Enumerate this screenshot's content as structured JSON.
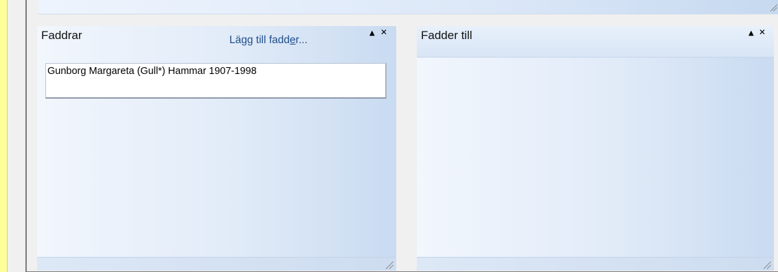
{
  "left_panel": {
    "title": "Faddrar",
    "add_link": {
      "prefix": "Lägg till fadd",
      "mnemonic": "e",
      "suffix": "r..."
    },
    "collapse_glyph": "▲",
    "close_glyph": "✕",
    "items": [
      {
        "label": "Gunborg Margareta (Gull*) Hammar 1907-1998"
      }
    ]
  },
  "right_panel": {
    "title": "Fadder till",
    "collapse_glyph": "▲",
    "close_glyph": "✕"
  },
  "icons": {
    "collapse": "triangle-up-icon",
    "close": "close-x-icon",
    "resize": "resize-grip-icon"
  },
  "colors": {
    "background": "#ffff99",
    "panel_gradient_start": "#f2f6fd",
    "panel_gradient_end": "#c9dbf1",
    "link": "#1f4e8c"
  }
}
